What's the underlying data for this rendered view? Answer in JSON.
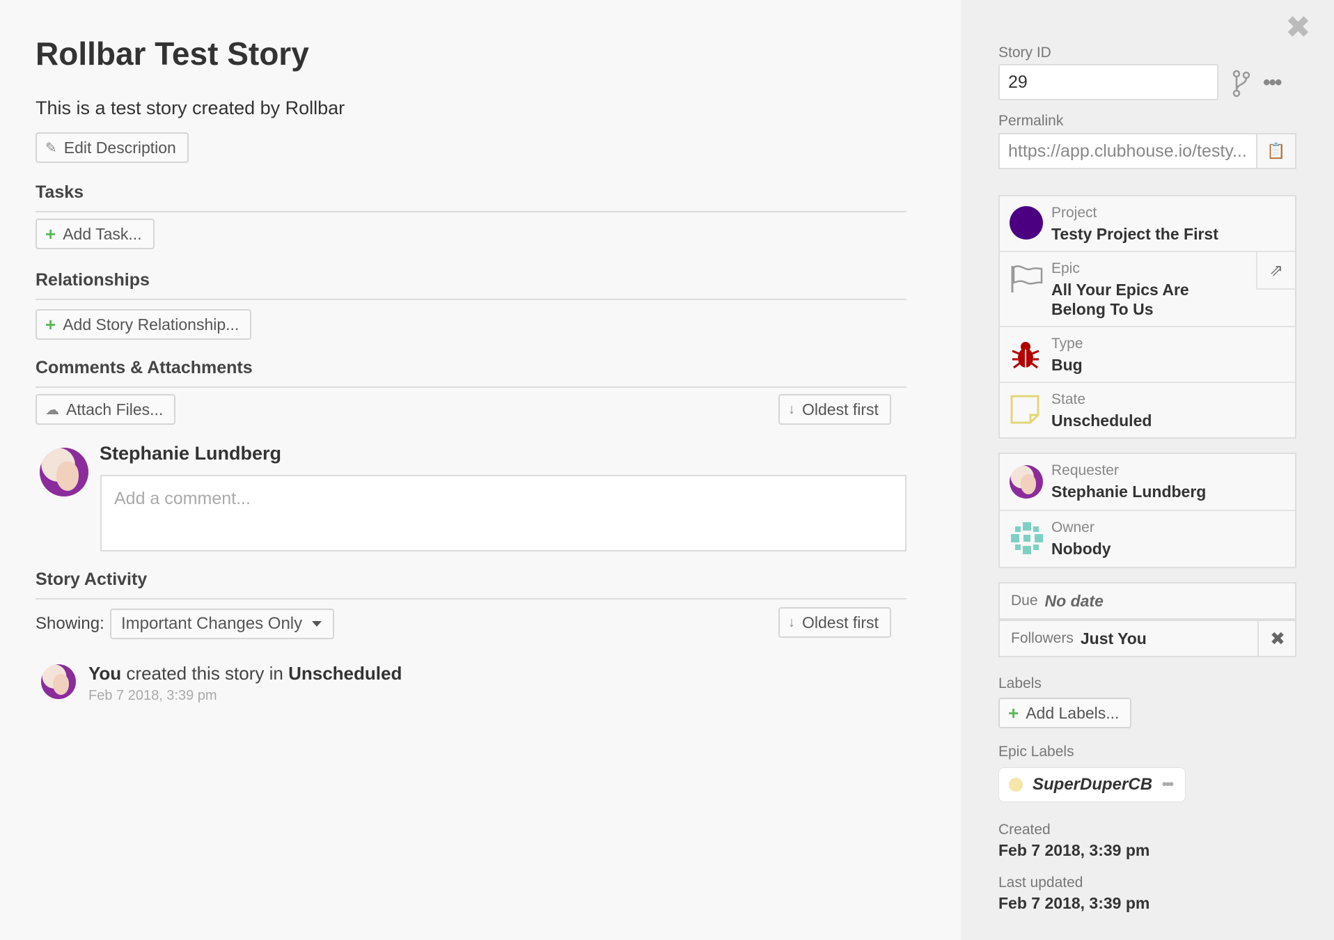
{
  "story": {
    "title": "Rollbar Test Story",
    "description": "This is a test story created by Rollbar",
    "edit_description_label": "Edit Description"
  },
  "sections": {
    "tasks": "Tasks",
    "add_task": "Add Task...",
    "relationships": "Relationships",
    "add_relationship": "Add Story Relationship...",
    "comments": "Comments & Attachments",
    "attach_files": "Attach Files...",
    "sort_order": "Oldest first",
    "activity": "Story Activity",
    "activity_sort": "Oldest first"
  },
  "comment": {
    "author": "Stephanie Lundberg",
    "placeholder": "Add a comment..."
  },
  "activity": {
    "showing_label": "Showing:",
    "filter": "Important Changes Only",
    "entry_actor": "You",
    "entry_text": " created this story in ",
    "entry_state": "Unscheduled",
    "entry_date": "Feb 7 2018, 3:39 pm"
  },
  "sidebar": {
    "story_id_label": "Story ID",
    "story_id": "29",
    "permalink_label": "Permalink",
    "permalink": "https://app.clubhouse.io/testy...",
    "project_label": "Project",
    "project": "Testy Project the First",
    "project_color": "#4b0082",
    "epic_label": "Epic",
    "epic": "All Your Epics Are Belong To Us",
    "type_label": "Type",
    "type": "Bug",
    "type_color": "#b30000",
    "state_label": "State",
    "state": "Unscheduled",
    "state_color": "#e2d679",
    "requester_label": "Requester",
    "requester": "Stephanie Lundberg",
    "owner_label": "Owner",
    "owner": "Nobody",
    "due_label": "Due",
    "due": "No date",
    "followers_label": "Followers",
    "followers": "Just You",
    "labels_label": "Labels",
    "add_labels": "Add Labels...",
    "epic_labels_label": "Epic Labels",
    "epic_label_name": "SuperDuperCB",
    "created_label": "Created",
    "created": "Feb 7 2018, 3:39 pm",
    "updated_label": "Last updated",
    "updated": "Feb 7 2018, 3:39 pm"
  }
}
